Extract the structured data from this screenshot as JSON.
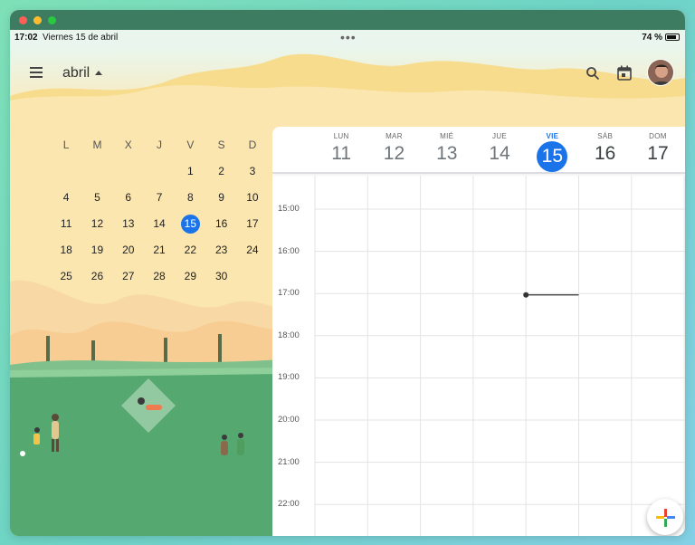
{
  "status_bar": {
    "time": "17:02",
    "date": "Viernes 15 de abril",
    "battery": "74 %"
  },
  "header": {
    "month": "abril",
    "icons": [
      "menu-icon",
      "search-icon",
      "calendar-today-icon",
      "avatar"
    ]
  },
  "mini_calendar": {
    "weekdays": [
      "L",
      "M",
      "X",
      "J",
      "V",
      "S",
      "D"
    ],
    "weeks": [
      [
        "",
        "",
        "",
        "",
        "1",
        "2",
        "3"
      ],
      [
        "4",
        "5",
        "6",
        "7",
        "8",
        "9",
        "10"
      ],
      [
        "11",
        "12",
        "13",
        "14",
        "15",
        "16",
        "17"
      ],
      [
        "18",
        "19",
        "20",
        "21",
        "22",
        "23",
        "24"
      ],
      [
        "25",
        "26",
        "27",
        "28",
        "29",
        "30",
        ""
      ]
    ],
    "today": "15"
  },
  "week_view": {
    "days": [
      {
        "name": "LUN",
        "num": "11"
      },
      {
        "name": "MAR",
        "num": "12"
      },
      {
        "name": "MIÉ",
        "num": "13"
      },
      {
        "name": "JUE",
        "num": "14"
      },
      {
        "name": "VIE",
        "num": "15"
      },
      {
        "name": "SÁB",
        "num": "16"
      },
      {
        "name": "DOM",
        "num": "17"
      }
    ],
    "today_index": 4,
    "times": [
      "15:00",
      "16:00",
      "17:00",
      "18:00",
      "19:00",
      "20:00",
      "21:00",
      "22:00"
    ]
  },
  "colors": {
    "accent": "#1a73e8",
    "sand": "#fbe9b7",
    "grass": "#55a870",
    "titlebar": "#3d7c61"
  }
}
